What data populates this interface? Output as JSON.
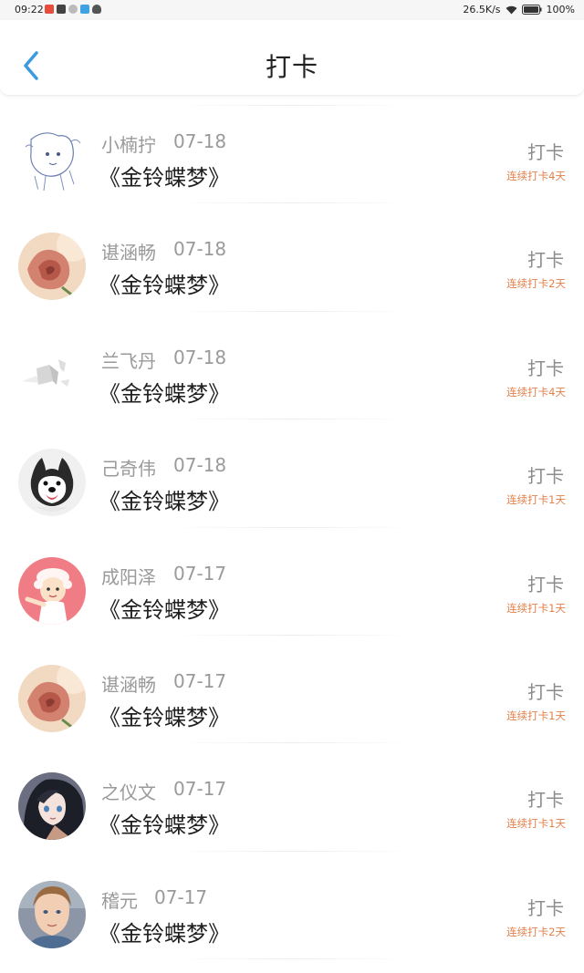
{
  "status_bar": {
    "time": "09:22",
    "net_speed": "26.5K/s",
    "battery": "100%",
    "notification_colors": [
      "#e74c3c",
      "#444444",
      "#aaaaaa",
      "#3fa2e3",
      "#666666"
    ]
  },
  "header": {
    "title": "打卡",
    "back_icon": "chevron-left-icon",
    "accent_color": "#3b9be0"
  },
  "items": [
    {
      "name": "小楠拧",
      "date": "07-18",
      "book": "《金铃蝶梦》",
      "action": "打卡",
      "streak": "连续打卡4天",
      "avatar": "sketch-girl"
    },
    {
      "name": "谌涵畅",
      "date": "07-18",
      "book": "《金铃蝶梦》",
      "action": "打卡",
      "streak": "连续打卡2天",
      "avatar": "rose"
    },
    {
      "name": "兰飞丹",
      "date": "07-18",
      "book": "《金铃蝶梦》",
      "action": "打卡",
      "streak": "连续打卡4天",
      "avatar": "gray-shapes"
    },
    {
      "name": "己奇伟",
      "date": "07-18",
      "book": "《金铃蝶梦》",
      "action": "打卡",
      "streak": "连续打卡1天",
      "avatar": "husky"
    },
    {
      "name": "成阳泽",
      "date": "07-17",
      "book": "《金铃蝶梦》",
      "action": "打卡",
      "streak": "连续打卡1天",
      "avatar": "cartoon-chef"
    },
    {
      "name": "谌涵畅",
      "date": "07-17",
      "book": "《金铃蝶梦》",
      "action": "打卡",
      "streak": "连续打卡1天",
      "avatar": "rose"
    },
    {
      "name": "之仪文",
      "date": "07-17",
      "book": "《金铃蝶梦》",
      "action": "打卡",
      "streak": "连续打卡1天",
      "avatar": "anime-girl"
    },
    {
      "name": "稽元",
      "date": "07-17",
      "book": "《金铃蝶梦》",
      "action": "打卡",
      "streak": "连续打卡2天",
      "avatar": "boy-photo"
    }
  ]
}
